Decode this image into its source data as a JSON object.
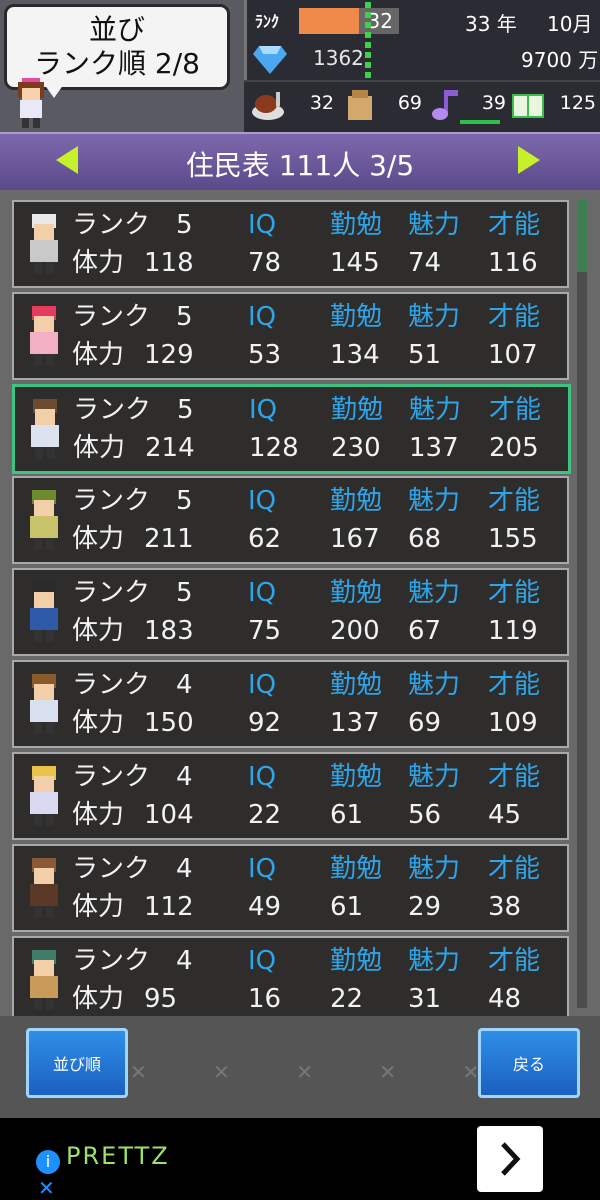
{
  "sort_panel": {
    "line1": "並び",
    "line2": "ランク順 2/8"
  },
  "stats": {
    "rank_label": "ﾗﾝｸ",
    "rank_value": "32",
    "rank_progress_fraction": 0.6,
    "gems": "1362",
    "year": "33 年",
    "month": "10月",
    "money": "9700 万"
  },
  "resources": {
    "food": "32",
    "items": "69",
    "music": "39",
    "books": "125"
  },
  "title": "住民表 111人 3/5",
  "labels": {
    "rank": "ランク",
    "hp": "体力",
    "iq": "IQ",
    "study": "勤勉",
    "charm": "魅力",
    "talent": "才能"
  },
  "residents": [
    {
      "rank": "5",
      "hp": "118",
      "iq": "78",
      "study": "145",
      "charm": "74",
      "talent": "116"
    },
    {
      "rank": "5",
      "hp": "129",
      "iq": "53",
      "study": "134",
      "charm": "51",
      "talent": "107"
    },
    {
      "rank": "5",
      "hp": "214",
      "iq": "128",
      "study": "230",
      "charm": "137",
      "talent": "205"
    },
    {
      "rank": "5",
      "hp": "211",
      "iq": "62",
      "study": "167",
      "charm": "68",
      "talent": "155"
    },
    {
      "rank": "5",
      "hp": "183",
      "iq": "75",
      "study": "200",
      "charm": "67",
      "talent": "119"
    },
    {
      "rank": "4",
      "hp": "150",
      "iq": "92",
      "study": "137",
      "charm": "69",
      "talent": "109"
    },
    {
      "rank": "4",
      "hp": "104",
      "iq": "22",
      "study": "61",
      "charm": "56",
      "talent": "45"
    },
    {
      "rank": "4",
      "hp": "112",
      "iq": "49",
      "study": "61",
      "charm": "29",
      "talent": "38"
    },
    {
      "rank": "4",
      "hp": "95",
      "iq": "16",
      "study": "22",
      "charm": "31",
      "talent": "48"
    }
  ],
  "buttons": {
    "sort": "並び順",
    "back": "戻る"
  },
  "ad": {
    "brand": "PRETTZ",
    "close": "✕"
  }
}
